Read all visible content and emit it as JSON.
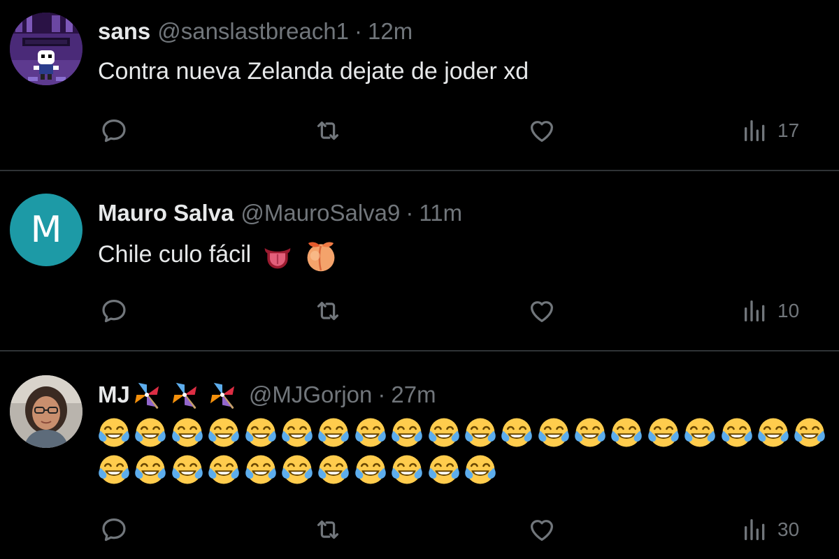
{
  "tweets": [
    {
      "display_name": "sans",
      "handle": "@sanslastbreach1",
      "separator": "·",
      "time": "12m",
      "text": "Contra nueva Zelanda dejate de joder xd",
      "views": "17",
      "avatar_icon": "pixel-skeleton-avatar"
    },
    {
      "display_name": "Mauro Salva",
      "handle": "@MauroSalva9",
      "separator": "·",
      "time": "11m",
      "text": "Chile culo fácil",
      "text_emojis": [
        "tongue-emoji",
        "peach-emoji"
      ],
      "views": "10",
      "avatar_letter": "M",
      "avatar_color": "#1d9aa6"
    },
    {
      "display_name": "MJ",
      "name_emojis": [
        "pinwheel-emoji",
        "pinwheel-emoji",
        "pinwheel-emoji"
      ],
      "handle": "@MJGorjon",
      "separator": "·",
      "time": "27m",
      "text_emoji": "face-with-tears-of-joy-emoji",
      "text_emoji_rows": [
        20,
        11
      ],
      "views": "30",
      "avatar_icon": "photo-avatar"
    }
  ],
  "colors": {
    "background": "#000000",
    "primary_text": "#e7e9ea",
    "secondary_text": "#71767b",
    "divider": "#2f3336"
  }
}
